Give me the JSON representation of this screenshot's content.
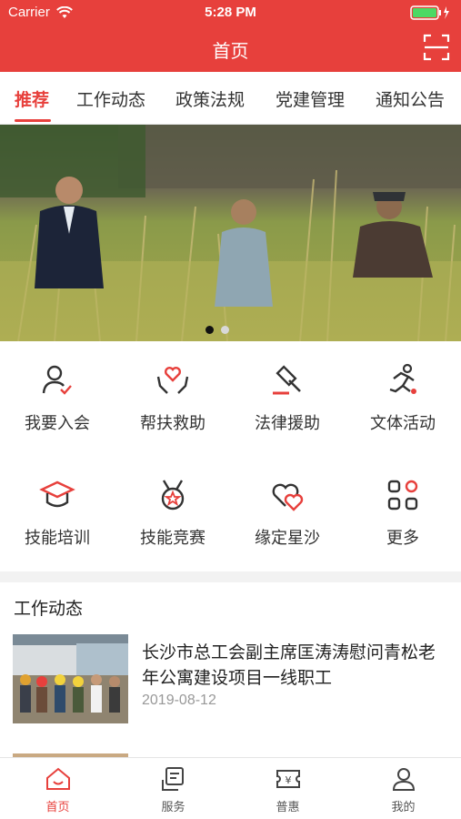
{
  "status_bar": {
    "carrier": "Carrier",
    "time": "5:28 PM"
  },
  "nav": {
    "title": "首页"
  },
  "tabs": [
    {
      "label": "推荐",
      "active": true
    },
    {
      "label": "工作动态"
    },
    {
      "label": "政策法规"
    },
    {
      "label": "党建管理"
    },
    {
      "label": "通知公告"
    }
  ],
  "grid": [
    {
      "label": "我要入会",
      "icon": "person-check-icon"
    },
    {
      "label": "帮扶救助",
      "icon": "hands-heart-icon"
    },
    {
      "label": "法律援助",
      "icon": "gavel-icon"
    },
    {
      "label": "文体活动",
      "icon": "runner-icon"
    },
    {
      "label": "技能培训",
      "icon": "graduation-cap-icon"
    },
    {
      "label": "技能竞赛",
      "icon": "medal-icon"
    },
    {
      "label": "缘定星沙",
      "icon": "double-heart-icon"
    },
    {
      "label": "更多",
      "icon": "more-grid-icon"
    }
  ],
  "section": {
    "title": "工作动态"
  },
  "news": [
    {
      "title": "长沙市总工会副主席匡涛涛慰问青松老年公寓建设项目一线职工",
      "date": "2019-08-12"
    }
  ],
  "tabbar": [
    {
      "label": "首页",
      "icon": "home-icon",
      "active": true
    },
    {
      "label": "服务",
      "icon": "service-icon"
    },
    {
      "label": "普惠",
      "icon": "ticket-icon"
    },
    {
      "label": "我的",
      "icon": "profile-icon"
    }
  ],
  "colors": {
    "accent": "#e7403c",
    "text": "#333333",
    "muted": "#999999"
  }
}
